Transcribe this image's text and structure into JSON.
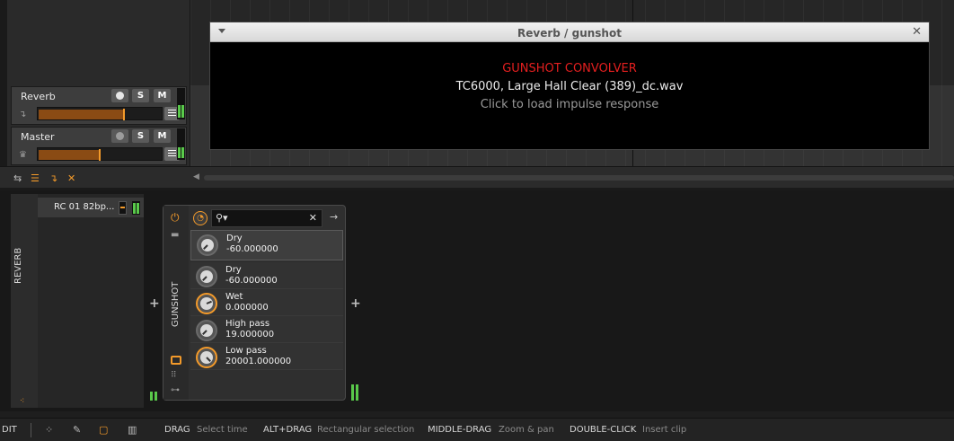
{
  "plugin_window": {
    "title": "Reverb / gunshot",
    "plugin_name": "GUNSHOT CONVOLVER",
    "impulse_file": "TC6000, Large Hall Clear (389)_dc.wav",
    "hint": "Click to load impulse response",
    "close_glyph": "✕"
  },
  "tracks": [
    {
      "name": "Reverb",
      "solo": "S",
      "mute": "M",
      "volume": 0.7
    },
    {
      "name": "Master",
      "solo": "S",
      "mute": "M",
      "volume": 0.5
    }
  ],
  "device_panel": {
    "track_label": "REVERB",
    "layer_name": "RC 01 82bp...",
    "device_name": "GUNSHOT",
    "search_placeholder": "",
    "highlight_param": {
      "name": "Dry",
      "value": "-60.000000"
    },
    "params": [
      {
        "name": "Dry",
        "value": "-60.000000",
        "knob": 0.0
      },
      {
        "name": "Wet",
        "value": "0.000000",
        "knob": 0.75
      },
      {
        "name": "High pass",
        "value": "19.000000",
        "knob": 0.0
      },
      {
        "name": "Low pass",
        "value": "20001.000000",
        "knob": 1.0
      }
    ]
  },
  "status_bar": {
    "mode": "DIT",
    "hints": [
      {
        "key": "DRAG",
        "desc": "Select time"
      },
      {
        "key": "ALT+DRAG",
        "desc": "Rectangular selection"
      },
      {
        "key": "MIDDLE-DRAG",
        "desc": "Zoom & pan"
      },
      {
        "key": "DOUBLE-CLICK",
        "desc": "Insert clip"
      }
    ]
  },
  "colors": {
    "accent": "#f39a2a",
    "plugin_title_red": "#e41f1f",
    "meter_green": "#59c94a",
    "background": "#181818"
  },
  "icons": [
    "record-icon",
    "menu-icon",
    "power-icon",
    "folder-icon",
    "search-icon",
    "close-icon",
    "arrow-right-icon",
    "crown-icon",
    "route-icon",
    "plus-icon"
  ]
}
